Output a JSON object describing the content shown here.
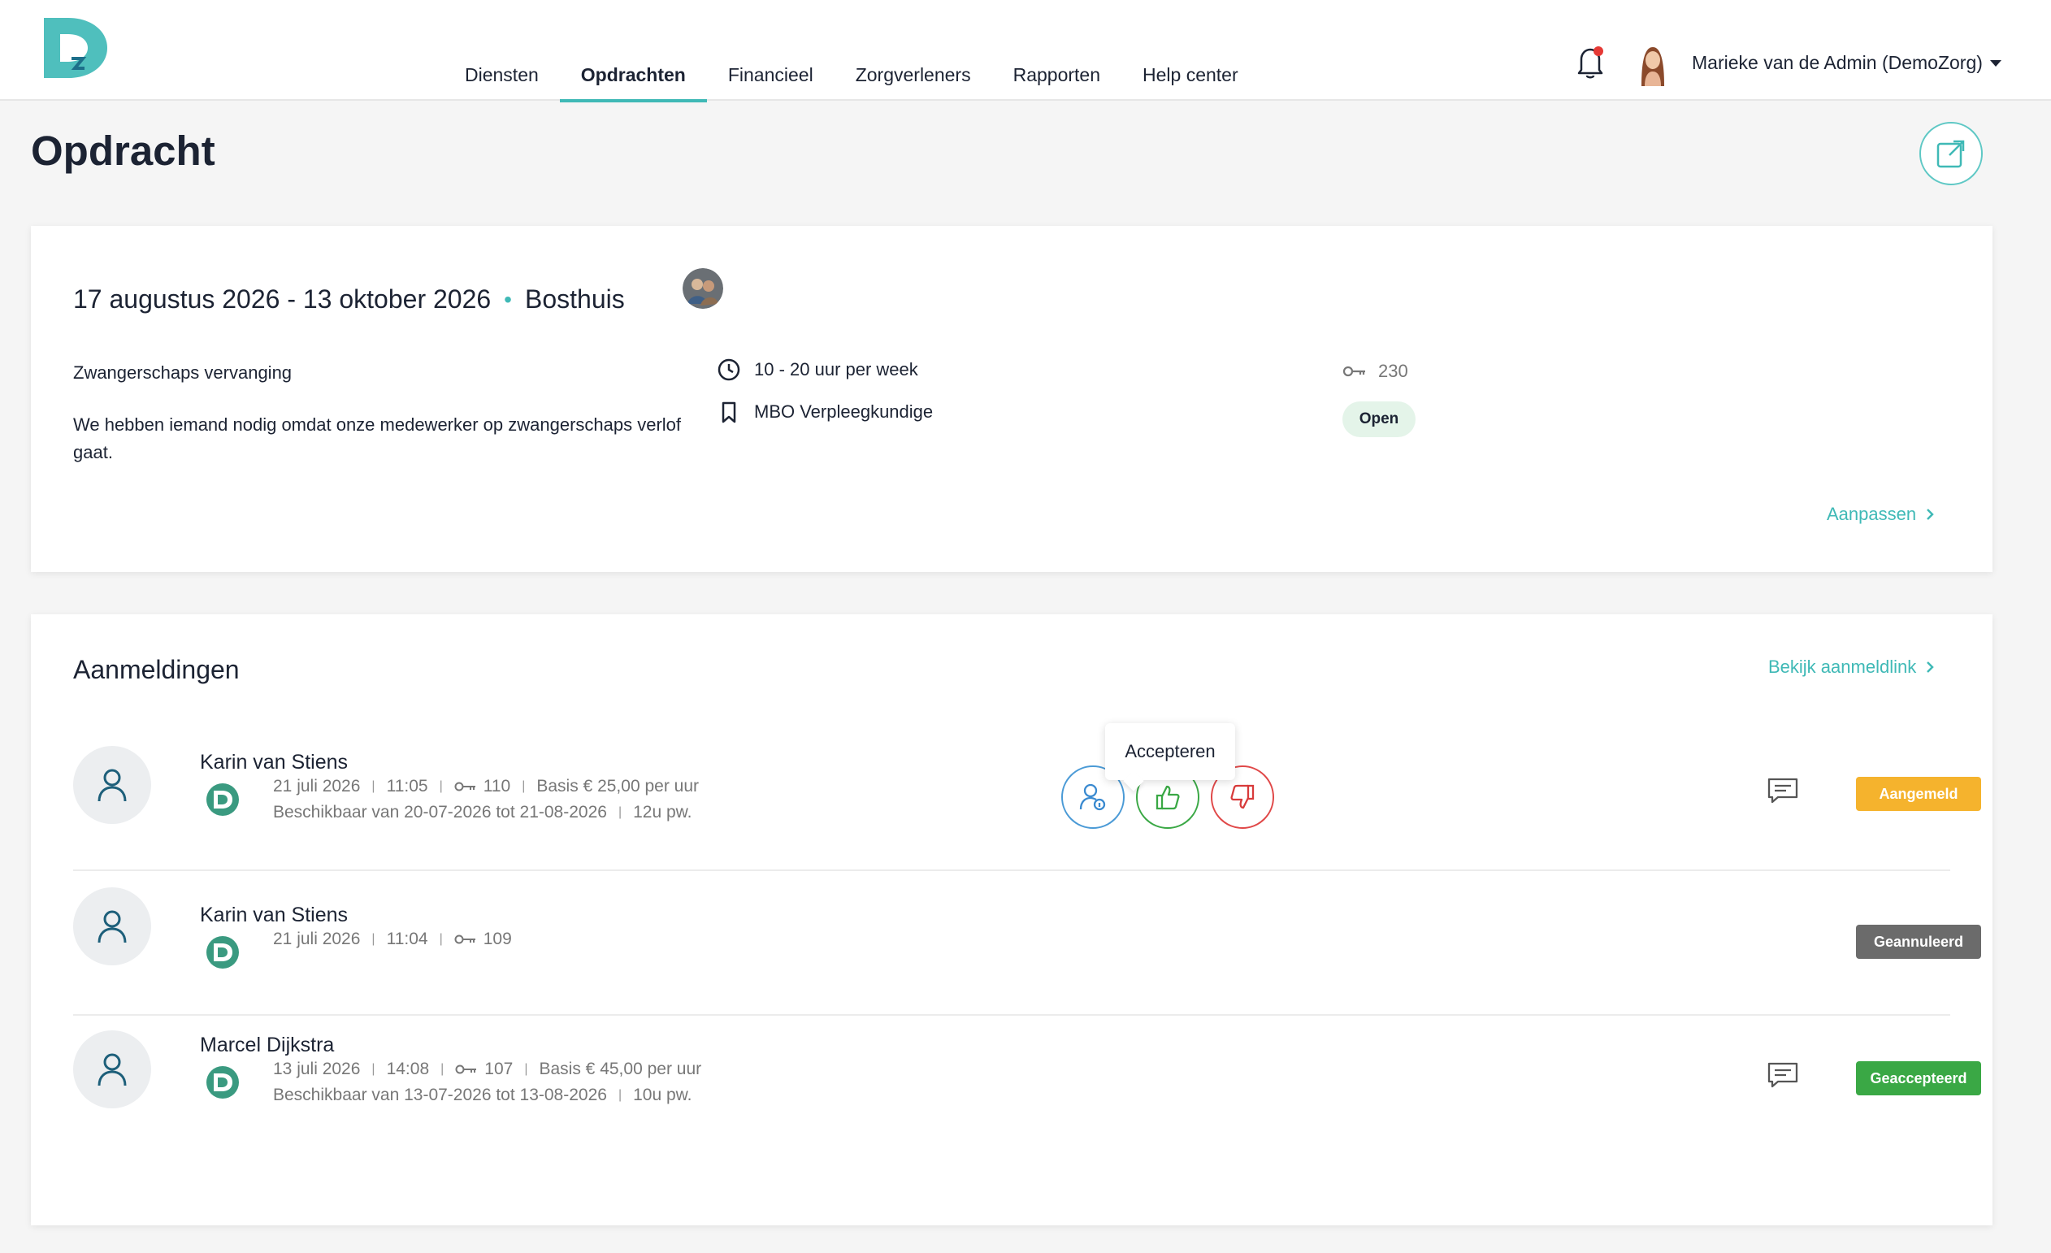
{
  "header": {
    "nav": [
      {
        "label": "Diensten"
      },
      {
        "label": "Opdrachten"
      },
      {
        "label": "Financieel"
      },
      {
        "label": "Zorgverleners"
      },
      {
        "label": "Rapporten"
      },
      {
        "label": "Help center"
      }
    ],
    "active_nav": "Opdrachten",
    "user_name": "Marieke van de Admin (DemoZorg)"
  },
  "page": {
    "title": "Opdracht"
  },
  "assignment": {
    "date_range": "17 augustus 2026 - 13 oktober 2026",
    "location": "Bosthuis",
    "description_title": "Zwangerschaps vervanging",
    "description": "We hebben iemand nodig omdat onze medewerker op zwangerschaps verlof gaat.",
    "hours": "10 - 20 uur per week",
    "function": "MBO Verpleegkundige",
    "reference": "230",
    "status": "Open",
    "edit_label": "Aanpassen"
  },
  "applications": {
    "title": "Aanmeldingen",
    "link_label": "Bekijk aanmeldlink",
    "tooltip": "Accepteren",
    "rows": [
      {
        "name": "Karin van Stiens",
        "date": "21 juli 2026",
        "time": "11:05",
        "ref": "110",
        "rate": "Basis € 25,00 per uur",
        "availability": "Beschikbaar van 20-07-2026 tot 21-08-2026",
        "hours": "12u pw.",
        "status": "Aangemeld"
      },
      {
        "name": "Karin van Stiens",
        "date": "21 juli 2026",
        "time": "11:04",
        "ref": "109",
        "status": "Geannuleerd"
      },
      {
        "name": "Marcel Dijkstra",
        "date": "13 juli 2026",
        "time": "14:08",
        "ref": "107",
        "rate": "Basis € 45,00 per uur",
        "availability": "Beschikbaar van 13-07-2026 tot 13-08-2026",
        "hours": "10u pw.",
        "status": "Geaccepteerd"
      }
    ]
  },
  "colors": {
    "brand": "#3fb9b6",
    "status_applied": "#f5b32d",
    "status_cancelled": "#6b6b6b",
    "status_accepted": "#3aa845",
    "open_badge_bg": "#e4f4e9"
  }
}
